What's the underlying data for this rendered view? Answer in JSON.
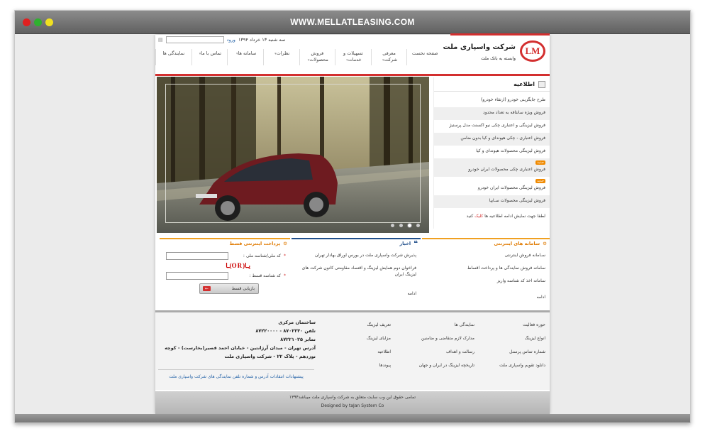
{
  "browser": {
    "url": "WWW.MELLATLEASING.COM"
  },
  "topbar": {
    "login_label": "ورود",
    "date": "سه شنبه ۱۳ خرداد ۱۳۹۴"
  },
  "logo": {
    "mark": "LM",
    "name": "شرکت واسپاری ملت",
    "subtitle": "وابسته به بانک ملت"
  },
  "nav": {
    "items": [
      {
        "label": "صفحه نخست"
      },
      {
        "label": "معرفی شرکت"
      },
      {
        "label": "تسهیلات و خدمات"
      },
      {
        "label": "فروش محصولات"
      },
      {
        "label": "نظرات"
      },
      {
        "label": "سامانه ها"
      },
      {
        "label": "تماس با ما"
      },
      {
        "label": "نمایندگی ها"
      }
    ]
  },
  "news": {
    "title": "اطلاعیه",
    "items": [
      {
        "text": "طرح جایگزینی خودرو (ارتقاء خودرو)",
        "badge": ""
      },
      {
        "text": "فروش ویژه سانتافه به تعداد محدود",
        "badge": ""
      },
      {
        "text": "فروش لیزینگی و اعتباری چکی نیو اکسنت مدل پرستیژ",
        "badge": ""
      },
      {
        "text": "فروش اعتباری - چکی هیوندای و کیا بدون ضامن",
        "badge": ""
      },
      {
        "text": "فروش لیزینگی محصولات هیوندای و کیا",
        "badge": ""
      },
      {
        "text": "فروش اعتباری چکی محصولات ایران خودرو",
        "badge": "جدید"
      },
      {
        "text": "فروش لیزینگی محصولات ایران خودرو",
        "badge": "جدید"
      },
      {
        "text": "فروش لیزینگی محصولات سـایپا",
        "badge": ""
      }
    ],
    "more_prefix": "لطفا جهت نمایش ادامه اطلاعیه ها",
    "more_link": "کلیک",
    "more_suffix": "کنید"
  },
  "slider": {
    "total_slides": 4,
    "active_slide": 2
  },
  "internet_systems": {
    "title": "سامانه های اینترنتی",
    "items": [
      "سـامانه فروش اینترنتی",
      "سامانه فروش نمایندگی ها و پرداخت اقساط",
      "سامانه اخذ کد شناسه واریز"
    ],
    "more": "ادامه"
  },
  "news_feed": {
    "title": "اخبار",
    "items": [
      "پذیرش شرکت واسپاری ملت در بورس اوراق بهادار تهران",
      "فراخوان دوم همایش لیزینگ و اقتصاد مقاومتی کانون شرکت های لیزینگ ایران"
    ],
    "more": "ادامه"
  },
  "payment": {
    "title": "پرداخت اینترنتی قسط",
    "national_id_label": "کد ملی/شناسه ملی :",
    "payment_id_label": "کد شناسه قسط :",
    "captcha": "یـا(OR)ـا",
    "button_label": "بازیابی قسط"
  },
  "footer": {
    "col1": [
      "حوزه فعالیت",
      "انواع لیزینگ",
      "شماره تماس پرسنل",
      "دانلود تقویم واسپاری ملت"
    ],
    "col2": [
      "نمایندگی ها",
      "مدارک لازم متقاضی و ضامنین",
      "رسالت و اهداف",
      "تاریخچه لیزینگ در ایران و جهان"
    ],
    "col3": [
      "تعریف لیزینگ",
      "مزایای لیزینگ",
      "اطلاعیه",
      "پیوندها"
    ],
    "contact": {
      "title": "ساختمان مرکزی",
      "phone": "تلفن ۸۷۰۲۲۳۰ - ۸۷۲۲۰۰۰۰",
      "fax": "نمابر ۸۷۲۲۱۰۲۵",
      "address": "آدرس تهران - میدان آرژانتین - خیابان احمد قصیر(بخارست) - کوچه نوزدهم - پلاک ۲۲ - شرکت واسپاری ملت"
    },
    "links": "پیشنهادات    انتقادات    آدرس و شماره تلفن نمایندگی های شرکت واسپاری ملت"
  },
  "copyright": {
    "text": "تمامی حقوق این وب سایت متعلق به شرکت واسپاری ملت میباشد۱۳۹۴",
    "designer": "Designed by taJan System Co"
  }
}
